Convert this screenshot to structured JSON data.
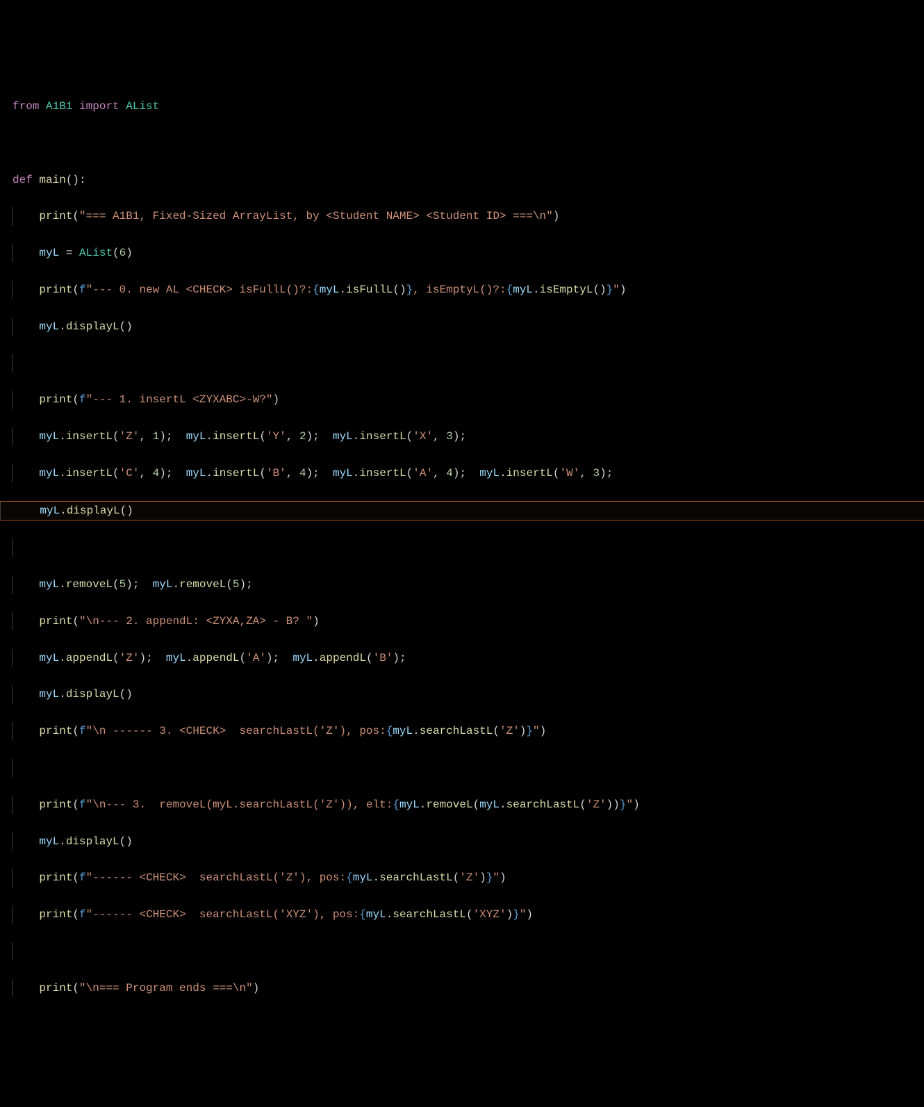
{
  "lines": {
    "l1": {
      "kw_from": "from",
      "mod": "A1B1",
      "kw_import": "import",
      "cls": "AList"
    },
    "l3": {
      "kw_def": "def",
      "fn": "main",
      "paren": "():"
    },
    "l4": {
      "fn": "print",
      "open": "(",
      "str": "\"=== A1B1, Fixed-Sized ArrayList, by <Student NAME> <Student ID> ===\\n\"",
      "close": ")"
    },
    "l5": {
      "var": "myL",
      "eq": " = ",
      "cls": "AList",
      "open": "(",
      "num": "6",
      "close": ")"
    },
    "l6": {
      "fn": "print",
      "open": "(",
      "f": "f",
      "q": "\"",
      "s1": "--- 0. new AL <CHECK> isFullL()?:",
      "ob1": "{",
      "e1_var": "myL",
      "e1_dot": ".",
      "e1_fn": "isFullL",
      "e1_p": "()",
      "cb1": "}",
      "s2": ", isEmptyL()?:",
      "ob2": "{",
      "e2_var": "myL",
      "e2_dot": ".",
      "e2_fn": "isEmptyL",
      "e2_p": "()",
      "cb2": "}",
      "eq": "\"",
      "close": ")"
    },
    "l7": {
      "var": "myL",
      "dot": ".",
      "fn": "displayL",
      "p": "()"
    },
    "l9": {
      "fn": "print",
      "open": "(",
      "f": "f",
      "q": "\"",
      "s": "--- 1. insertL <ZYXABC>-W?",
      "eq": "\"",
      "close": ")"
    },
    "l10": {
      "c1_v": "myL",
      "c1_d": ".",
      "c1_f": "insertL",
      "c1_o": "(",
      "c1_s": "'Z'",
      "c1_c": ", ",
      "c1_n": "1",
      "c1_cl": ");  ",
      "c2_v": "myL",
      "c2_d": ".",
      "c2_f": "insertL",
      "c2_o": "(",
      "c2_s": "'Y'",
      "c2_c": ", ",
      "c2_n": "2",
      "c2_cl": ");  ",
      "c3_v": "myL",
      "c3_d": ".",
      "c3_f": "insertL",
      "c3_o": "(",
      "c3_s": "'X'",
      "c3_c": ", ",
      "c3_n": "3",
      "c3_cl": ");"
    },
    "l11": {
      "c1_v": "myL",
      "c1_d": ".",
      "c1_f": "insertL",
      "c1_o": "(",
      "c1_s": "'C'",
      "c1_c": ", ",
      "c1_n": "4",
      "c1_cl": ");  ",
      "c2_v": "myL",
      "c2_d": ".",
      "c2_f": "insertL",
      "c2_o": "(",
      "c2_s": "'B'",
      "c2_c": ", ",
      "c2_n": "4",
      "c2_cl": ");  ",
      "c3_v": "myL",
      "c3_d": ".",
      "c3_f": "insertL",
      "c3_o": "(",
      "c3_s": "'A'",
      "c3_c": ", ",
      "c3_n": "4",
      "c3_cl": ");  ",
      "c4_v": "myL",
      "c4_d": ".",
      "c4_f": "insertL",
      "c4_o": "(",
      "c4_s": "'W'",
      "c4_c": ", ",
      "c4_n": "3",
      "c4_cl": ");"
    },
    "l12": {
      "var": "myL",
      "dot": ".",
      "fn": "displayL",
      "p": "()"
    },
    "l14": {
      "c1_v": "myL",
      "c1_d": ".",
      "c1_f": "removeL",
      "c1_o": "(",
      "c1_n": "5",
      "c1_cl": ");  ",
      "c2_v": "myL",
      "c2_d": ".",
      "c2_f": "removeL",
      "c2_o": "(",
      "c2_n": "5",
      "c2_cl": ");"
    },
    "l15": {
      "fn": "print",
      "open": "(",
      "str": "\"\\n--- 2. appendL: <ZYXA,ZA> - B? \"",
      "close": ")"
    },
    "l16": {
      "c1_v": "myL",
      "c1_d": ".",
      "c1_f": "appendL",
      "c1_o": "(",
      "c1_s": "'Z'",
      "c1_cl": ");  ",
      "c2_v": "myL",
      "c2_d": ".",
      "c2_f": "appendL",
      "c2_o": "(",
      "c2_s": "'A'",
      "c2_cl": ");  ",
      "c3_v": "myL",
      "c3_d": ".",
      "c3_f": "appendL",
      "c3_o": "(",
      "c3_s": "'B'",
      "c3_cl": ");"
    },
    "l17": {
      "var": "myL",
      "dot": ".",
      "fn": "displayL",
      "p": "()"
    },
    "l18": {
      "fn": "print",
      "open": "(",
      "f": "f",
      "q": "\"",
      "s1": "\\n ------ 3. <CHECK>  searchLastL('Z'), pos:",
      "ob": "{",
      "e_var": "myL",
      "e_dot": ".",
      "e_fn": "searchLastL",
      "e_o": "(",
      "e_s": "'Z'",
      "e_cl": ")",
      "cb": "}",
      "eq": "\"",
      "close": ")"
    },
    "l20": {
      "fn": "print",
      "open": "(",
      "f": "f",
      "q": "\"",
      "s1": "\\n--- 3.  removeL(myL.searchLastL('Z')), elt:",
      "ob": "{",
      "e_var": "myL",
      "e_dot": ".",
      "e_fn": "removeL",
      "e_o": "(",
      "i_var": "myL",
      "i_dot": ".",
      "i_fn": "searchLastL",
      "i_o": "(",
      "i_s": "'Z'",
      "i_cl": ")",
      "e_cl": ")",
      "cb": "}",
      "eq": "\"",
      "close": ")"
    },
    "l21": {
      "var": "myL",
      "dot": ".",
      "fn": "displayL",
      "p": "()"
    },
    "l22": {
      "fn": "print",
      "open": "(",
      "f": "f",
      "q": "\"",
      "s1": "------ <CHECK>  searchLastL('Z'), pos:",
      "ob": "{",
      "e_var": "myL",
      "e_dot": ".",
      "e_fn": "searchLastL",
      "e_o": "(",
      "e_s": "'Z'",
      "e_cl": ")",
      "cb": "}",
      "eq": "\"",
      "close": ")"
    },
    "l23": {
      "fn": "print",
      "open": "(",
      "f": "f",
      "q": "\"",
      "s1": "------ <CHECK>  searchLastL('XYZ'), pos:",
      "ob": "{",
      "e_var": "myL",
      "e_dot": ".",
      "e_fn": "searchLastL",
      "e_o": "(",
      "e_s": "'XYZ'",
      "e_cl": ")",
      "cb": "}",
      "eq": "\"",
      "close": ")"
    },
    "l25": {
      "fn": "print",
      "open": "(",
      "str": "\"\\n=== Program ends ===\\n\"",
      "close": ")"
    }
  },
  "indent": "    "
}
